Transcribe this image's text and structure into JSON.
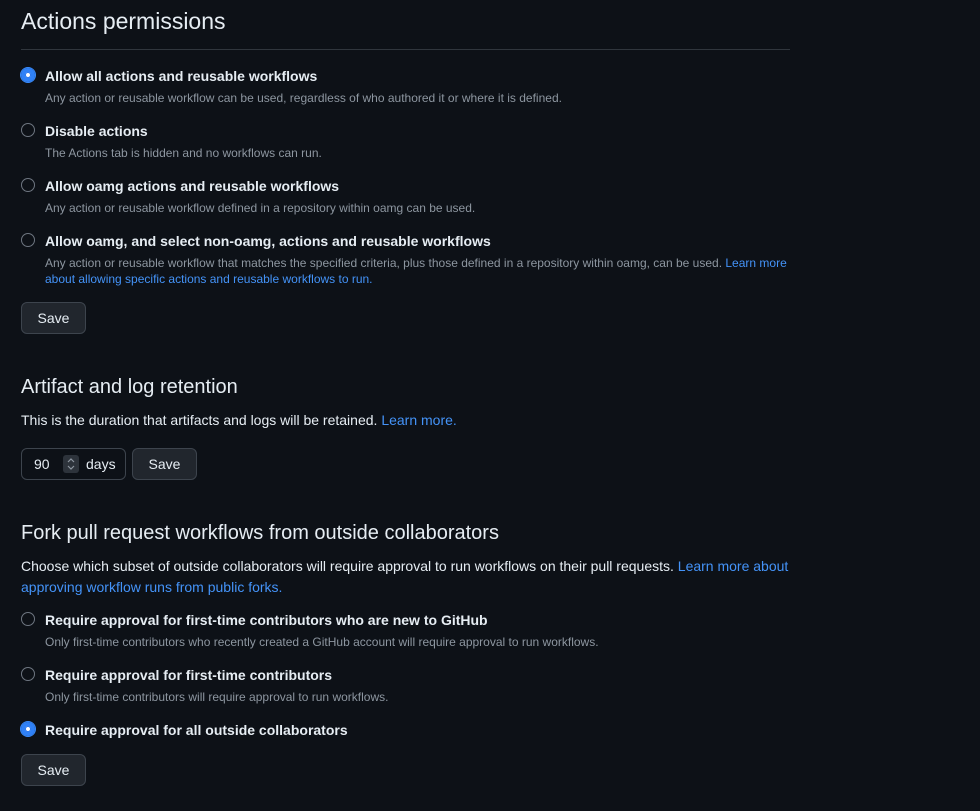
{
  "actions_permissions": {
    "title": "Actions permissions",
    "options": [
      {
        "label": "Allow all actions and reusable workflows",
        "description": "Any action or reusable workflow can be used, regardless of who authored it or where it is defined.",
        "checked": true
      },
      {
        "label": "Disable actions",
        "description": "The Actions tab is hidden and no workflows can run.",
        "checked": false
      },
      {
        "label": "Allow oamg actions and reusable workflows",
        "description": "Any action or reusable workflow defined in a repository within oamg can be used.",
        "checked": false
      },
      {
        "label": "Allow oamg, and select non-oamg, actions and reusable workflows",
        "description": "Any action or reusable workflow that matches the specified criteria, plus those defined in a repository within oamg, can be used.",
        "link": "Learn more about allowing specific actions and reusable workflows to run.",
        "checked": false
      }
    ],
    "save_label": "Save"
  },
  "retention": {
    "title": "Artifact and log retention",
    "description": "This is the duration that artifacts and logs will be retained.",
    "link": "Learn more.",
    "days_value": "90",
    "days_suffix": "days",
    "save_label": "Save"
  },
  "fork_pr": {
    "title": "Fork pull request workflows from outside collaborators",
    "description": "Choose which subset of outside collaborators will require approval to run workflows on their pull requests.",
    "link": "Learn more about approving workflow runs from public forks.",
    "options": [
      {
        "label": "Require approval for first-time contributors who are new to GitHub",
        "description": "Only first-time contributors who recently created a GitHub account will require approval to run workflows.",
        "checked": false
      },
      {
        "label": "Require approval for first-time contributors",
        "description": "Only first-time contributors will require approval to run workflows.",
        "checked": false
      },
      {
        "label": "Require approval for all outside collaborators",
        "checked": true
      }
    ],
    "save_label": "Save"
  },
  "colors": {
    "background": "#0d1117",
    "accent": "#2f81f7",
    "link": "#4493f8",
    "muted_text": "#8d96a0"
  }
}
